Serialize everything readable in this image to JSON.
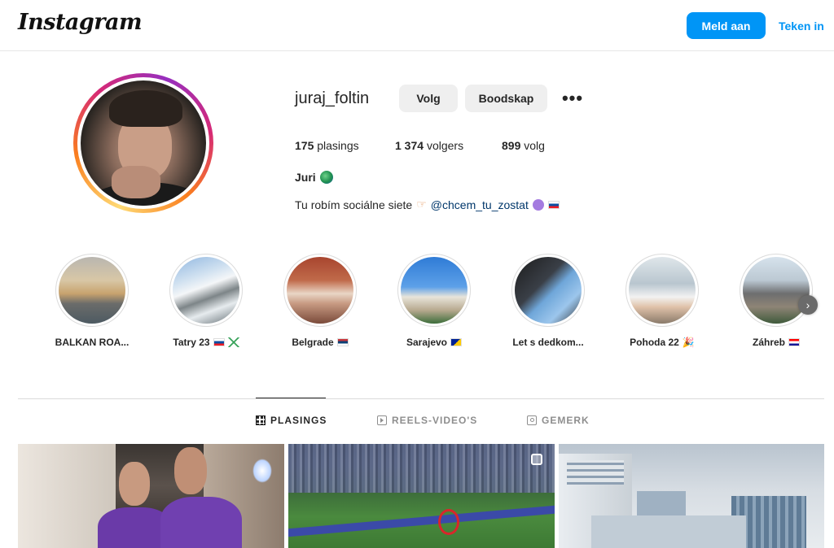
{
  "header": {
    "logo": "Instagram",
    "login_label": "Meld aan",
    "signup_label": "Teken in",
    "accent": "#0095f6"
  },
  "profile": {
    "username": "juraj_foltin",
    "follow_label": "Volg",
    "message_label": "Boodskap",
    "more_label": "•••",
    "stats": {
      "posts_count": "175",
      "posts_label": "plasings",
      "followers_count": "1 374",
      "followers_label": "volgers",
      "following_count": "899",
      "following_label": "volg"
    },
    "full_name": "Juri",
    "bio_text": "Tu robím sociálne siete",
    "bio_mention": "@chcem_tu_zostat"
  },
  "highlights": [
    {
      "label": "BALKAN ROA..."
    },
    {
      "label": "Tatry 23"
    },
    {
      "label": "Belgrade"
    },
    {
      "label": "Sarajevo"
    },
    {
      "label": "Let s dedkom..."
    },
    {
      "label": "Pohoda 22"
    },
    {
      "label": "Záhreb"
    }
  ],
  "tabs": [
    {
      "label": "PLASINGS",
      "icon": "grid-icon",
      "active": true
    },
    {
      "label": "REELS-VIDEO'S",
      "icon": "reels-icon",
      "active": false
    },
    {
      "label": "GEMERK",
      "icon": "tagged-icon",
      "active": false
    }
  ],
  "posts": [
    {
      "description_icon": "photo"
    },
    {
      "description_icon": "carousel"
    },
    {
      "description_icon": "photo"
    }
  ]
}
